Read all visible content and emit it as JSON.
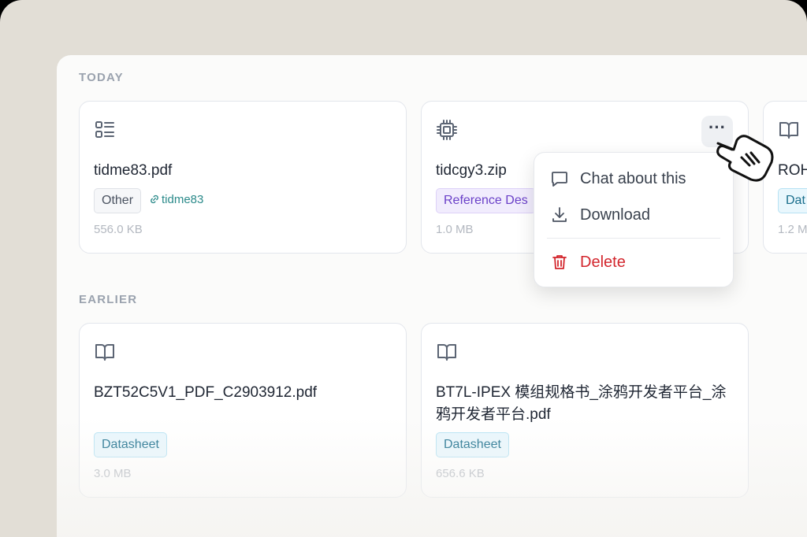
{
  "sections": {
    "today": "TODAY",
    "earlier": "EARLIER"
  },
  "today_cards": [
    {
      "name": "tidme83.pdf",
      "tag": "Other",
      "link": "tidme83",
      "size": "556.0 KB",
      "icon": "list-icon"
    },
    {
      "name": "tidcgy3.zip",
      "tag": "Reference Des",
      "size": "1.0 MB",
      "icon": "chip-icon"
    },
    {
      "name": "ROH",
      "tag": "Dat",
      "size": "1.2 M",
      "icon": "book-icon"
    }
  ],
  "earlier_cards": [
    {
      "name": "BZT52C5V1_PDF_C2903912.pdf",
      "tag": "Datasheet",
      "size": "3.0 MB",
      "icon": "book-icon"
    },
    {
      "name": "BT7L-IPEX 模组规格书_涂鸦开发者平台_涂鸦开发者平台.pdf",
      "tag": "Datasheet",
      "size": "656.6 KB",
      "icon": "book-icon"
    }
  ],
  "more_button": "···",
  "context_menu": {
    "chat": "Chat about this",
    "download": "Download",
    "delete": "Delete"
  },
  "colors": {
    "accent_purple": "#6a40c8",
    "accent_teal": "#1a6e8c",
    "danger": "#d3262d"
  }
}
